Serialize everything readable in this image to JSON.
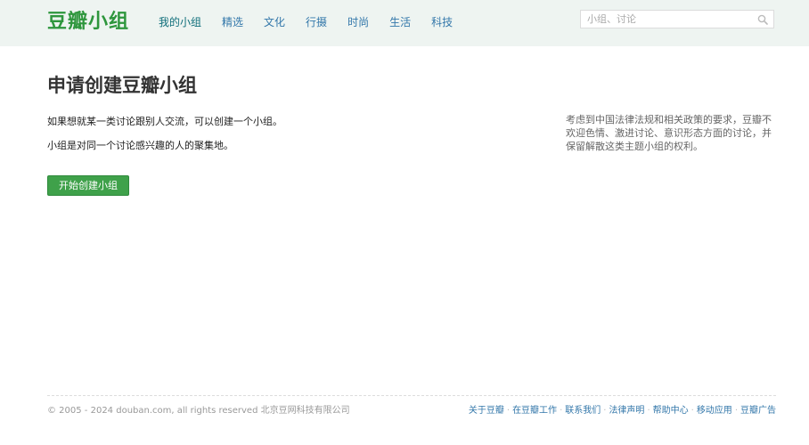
{
  "header": {
    "logo": "豆瓣小组",
    "nav": [
      "我的小组",
      "精选",
      "文化",
      "行摄",
      "时尚",
      "生活",
      "科技"
    ],
    "search_placeholder": "小组、讨论",
    "search_icon": "search-icon"
  },
  "main": {
    "title": "申请创建豆瓣小组",
    "intro_line1": "如果想就某一类讨论跟别人交流，可以创建一个小组。",
    "intro_line2": "小组是对同一个讨论感兴趣的人的聚集地。",
    "create_button": "开始创建小组",
    "notice": "考虑到中国法律法规和相关政策的要求，豆瓣不欢迎色情、激进讨论、意识形态方面的讨论，并保留解散这类主题小组的权利。"
  },
  "footer": {
    "copyright": "© 2005 - 2024 douban.com, all rights reserved 北京豆网科技有限公司",
    "links": [
      "关于豆瓣",
      "在豆瓣工作",
      "联系我们",
      "法律声明",
      "帮助中心",
      "移动应用",
      "豆瓣广告"
    ]
  },
  "colors": {
    "brand_green": "#2e963d",
    "button_green": "#3fa14a",
    "link_blue": "#3377aa",
    "header_bg": "#eef4f1"
  }
}
